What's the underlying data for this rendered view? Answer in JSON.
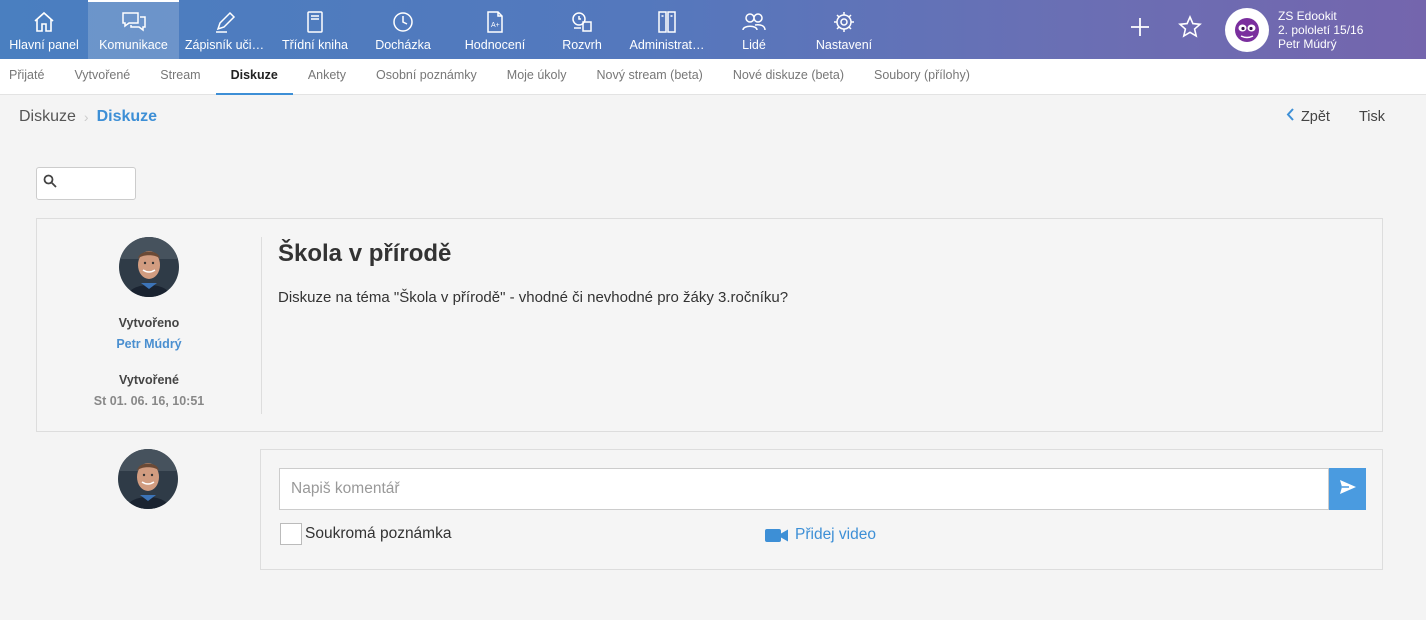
{
  "nav": {
    "items": [
      {
        "label": "Hlavní panel",
        "icon": "home-icon"
      },
      {
        "label": "Komunikace",
        "icon": "chat-icon",
        "active": true
      },
      {
        "label": "Zápisník uči…",
        "icon": "pen-icon"
      },
      {
        "label": "Třídní kniha",
        "icon": "book-icon"
      },
      {
        "label": "Docházka",
        "icon": "clock-icon"
      },
      {
        "label": "Hodnocení",
        "icon": "grade-icon"
      },
      {
        "label": "Rozvrh",
        "icon": "schedule-icon"
      },
      {
        "label": "Administrat…",
        "icon": "admin-icon"
      },
      {
        "label": "Lidé",
        "icon": "people-icon"
      },
      {
        "label": "Nastavení",
        "icon": "gear-icon"
      }
    ]
  },
  "profile": {
    "school": "ZS Edookit",
    "period": "2. pololetí 15/16",
    "user": "Petr Múdrý"
  },
  "subnav": {
    "items": [
      "Přijaté",
      "Vytvořené",
      "Stream",
      "Diskuze",
      "Ankety",
      "Osobní poznámky",
      "Moje úkoly",
      "Nový stream (beta)",
      "Nové diskuze (beta)",
      "Soubory (přílohy)"
    ],
    "active": "Diskuze"
  },
  "breadcrumb": {
    "parent": "Diskuze",
    "current": "Diskuze"
  },
  "actions": {
    "back": "Zpět",
    "print": "Tisk"
  },
  "post": {
    "created_label": "Vytvořeno",
    "author": "Petr Múdrý",
    "type_label": "Vytvořené",
    "date": "St 01. 06. 16, 10:51",
    "title": "Škola v přírodě",
    "body": "Diskuze na téma \"Škola v přírodě\" - vhodné či nevhodné pro žáky 3.ročníku?"
  },
  "comment": {
    "placeholder": "Napiš komentář",
    "private_label": "Soukromá poznámka",
    "video_label": "Přidej video"
  },
  "colors": {
    "accent": "#3d8fd6",
    "send_button": "#4a9be0"
  }
}
